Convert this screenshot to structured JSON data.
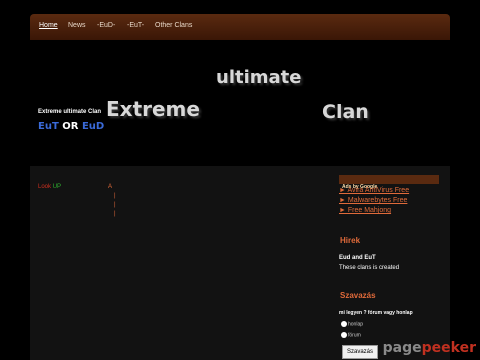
{
  "nav": {
    "items": [
      {
        "label": "Home",
        "active": true
      },
      {
        "label": "News"
      },
      {
        "label": "-EuD-"
      },
      {
        "label": "-EuT-"
      },
      {
        "label": "Other Clans"
      }
    ]
  },
  "header": {
    "logo_word1": "ultimate",
    "logo_word2": "Extreme",
    "logo_word3": "Clan",
    "tagline": "Extreme ultimate Clan",
    "tag_eut": "EuT",
    "tag_or": "OR",
    "tag_eud": "EuD"
  },
  "main": {
    "look": "Look",
    "up": "UP",
    "symbol_a": "A",
    "bar1": "|",
    "bar2": "|",
    "bar3": "|"
  },
  "ads": {
    "header": "Ads by Google",
    "links": [
      "► Avira AntiVirus Free",
      "► Malwarebytes Free",
      "► Free Mahjong"
    ]
  },
  "hirek": {
    "title": "Hirek",
    "headline": "Eud and EuT",
    "text": "These clans is created"
  },
  "szavazas": {
    "title": "Szavazás",
    "question": "mi legyen ? fórum vagy honlap",
    "options": [
      "honlap",
      "fórum"
    ],
    "button": "Szavazás"
  },
  "watermark": {
    "part1": "page",
    "part2": "peeker"
  },
  "colors": {
    "accent": "#e06a3a",
    "nav_bg": "#5a2a10",
    "eut": "#3a6ad8",
    "or": "#fff",
    "eud": "#3a6ad8"
  }
}
